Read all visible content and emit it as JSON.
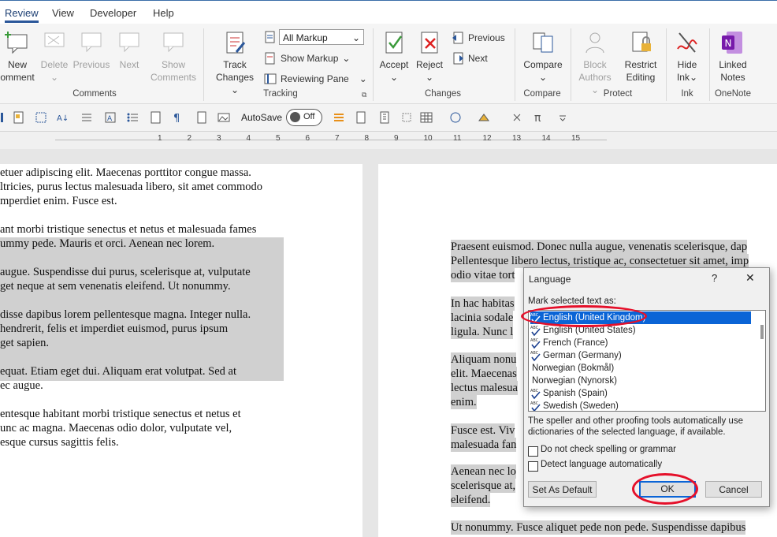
{
  "tabs": [
    "Review",
    "View",
    "Developer",
    "Help"
  ],
  "ribbon": {
    "comments": {
      "new_line1": "New",
      "new_line2": "omment",
      "delete": "Delete",
      "previous": "Previous",
      "next": "Next",
      "show_line1": "Show",
      "show_line2": "Comments",
      "label": "Comments"
    },
    "tracking": {
      "track_line1": "Track",
      "track_line2": "Changes",
      "markup_dropdown": "All Markup",
      "show_markup": "Show Markup",
      "reviewing_pane": "Reviewing Pane",
      "label": "Tracking"
    },
    "changes": {
      "accept": "Accept",
      "reject": "Reject",
      "previous": "Previous",
      "next": "Next",
      "label": "Changes"
    },
    "compare": {
      "compare": "Compare",
      "label": "Compare"
    },
    "protect": {
      "block_line1": "Block",
      "block_line2": "Authors",
      "restrict_line1": "Restrict",
      "restrict_line2": "Editing",
      "label": "Protect"
    },
    "ink": {
      "hide_line1": "Hide",
      "hide_line2": "Ink",
      "label": "Ink"
    },
    "onenote": {
      "linked_line1": "Linked",
      "linked_line2": "Notes",
      "label": "OneNote"
    }
  },
  "qat": {
    "autosave_label": "AutoSave",
    "autosave_state": "Off"
  },
  "ruler": {
    "ticks": [
      "1",
      "2",
      "3",
      "4",
      "5",
      "6",
      "7",
      "8",
      "9",
      "10",
      "11",
      "12",
      "13",
      "14",
      "15"
    ]
  },
  "left_page": {
    "lines": [
      "etuer adipiscing elit. Maecenas porttitor congue massa.",
      "ltricies, purus lectus malesuada libero, sit amet commodo",
      "mperdiet enim. Fusce est.",
      "ant morbi tristique senectus et netus et malesuada fames",
      "ummy pede. Mauris et orci. Aenean nec lorem.",
      "augue. Suspendisse dui purus, scelerisque at, vulputate",
      "get neque at sem venenatis eleifend. Ut nonummy.",
      "disse dapibus lorem pellentesque magna. Integer nulla.",
      "hendrerit, felis et imperdiet euismod, purus ipsum",
      "get sapien.",
      "equat. Etiam eget dui. Aliquam erat volutpat. Sed at",
      "ec augue.",
      "entesque habitant morbi tristique senectus et netus et",
      "unc ac magna. Maecenas odio dolor, vulputate vel,",
      "esque cursus sagittis felis."
    ]
  },
  "right_page": {
    "lines": [
      "Praesent euismod. Donec nulla augue, venenatis scelerisque, dap",
      "Pellentesque libero lectus, tristique ac, consectetuer sit amet, imp",
      "odio vitae tort",
      "In hac habitas",
      "lacinia sodale",
      "ligula. Nunc l",
      "Aliquam nonu",
      "elit. Maecenas",
      "lectus malesua",
      "enim.",
      "Fusce est. Viv",
      "malesuada fan",
      "Aenean nec lo",
      "scelerisque at,",
      "eleifend.",
      "Ut nonummy. Fusce aliquet pede non pede. Suspendisse dapibus"
    ]
  },
  "dialog": {
    "title": "Language",
    "help": "?",
    "close": "✕",
    "list_label": "Mark selected text as:",
    "languages": [
      {
        "name": "English (United Kingdom)",
        "spell": true,
        "selected": true
      },
      {
        "name": "English (United States)",
        "spell": true,
        "selected": false
      },
      {
        "name": "French (France)",
        "spell": true,
        "selected": false
      },
      {
        "name": "German (Germany)",
        "spell": true,
        "selected": false
      },
      {
        "name": "Norwegian (Bokmål)",
        "spell": false,
        "selected": false
      },
      {
        "name": "Norwegian (Nynorsk)",
        "spell": false,
        "selected": false
      },
      {
        "name": "Spanish (Spain)",
        "spell": true,
        "selected": false
      },
      {
        "name": "Swedish (Sweden)",
        "spell": true,
        "selected": false
      }
    ],
    "info": "The speller and other proofing tools automatically use dictionaries of the selected language, if available.",
    "checkbox_no_spell": "Do not check spelling or grammar",
    "checkbox_detect": "Detect language automatically",
    "set_default": "Set As Default",
    "ok": "OK",
    "cancel": "Cancel"
  },
  "colors": {
    "accent": "#2b579a",
    "selection": "#0a64d6",
    "highlight_oval": "#e5102a"
  }
}
